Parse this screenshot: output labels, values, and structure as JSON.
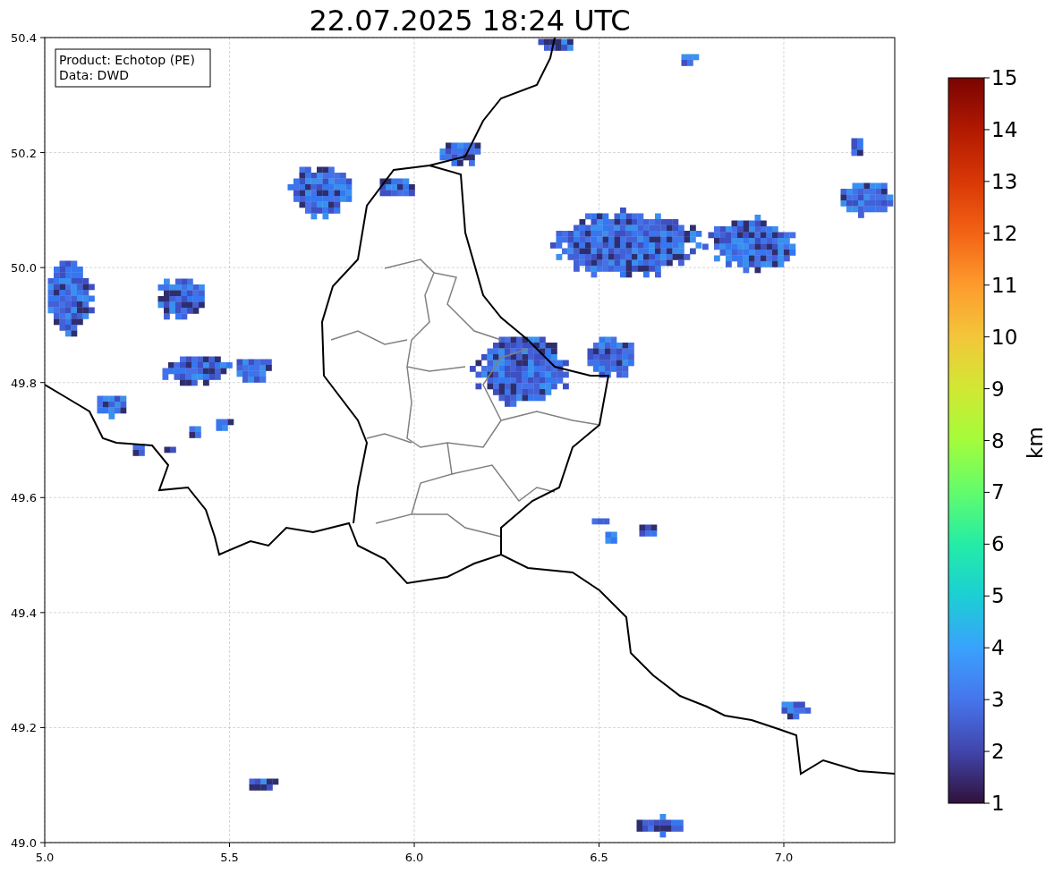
{
  "title": "22.07.2025 18:24 UTC",
  "info_box": [
    "Product: Echotop (PE)",
    "Data: DWD"
  ],
  "x_axis": {
    "ticks": [
      "5.0",
      "5.5",
      "6.0",
      "6.5",
      "7.0"
    ]
  },
  "y_axis": {
    "ticks": [
      "50.4",
      "50.2",
      "50.0",
      "49.8",
      "49.6",
      "49.4",
      "49.2",
      "49.0"
    ]
  },
  "colorbar": {
    "label": "km",
    "ticks": [
      "15",
      "14",
      "13",
      "12",
      "11",
      "10",
      "9",
      "8",
      "7",
      "6",
      "5",
      "4",
      "3",
      "2",
      "1"
    ]
  }
}
